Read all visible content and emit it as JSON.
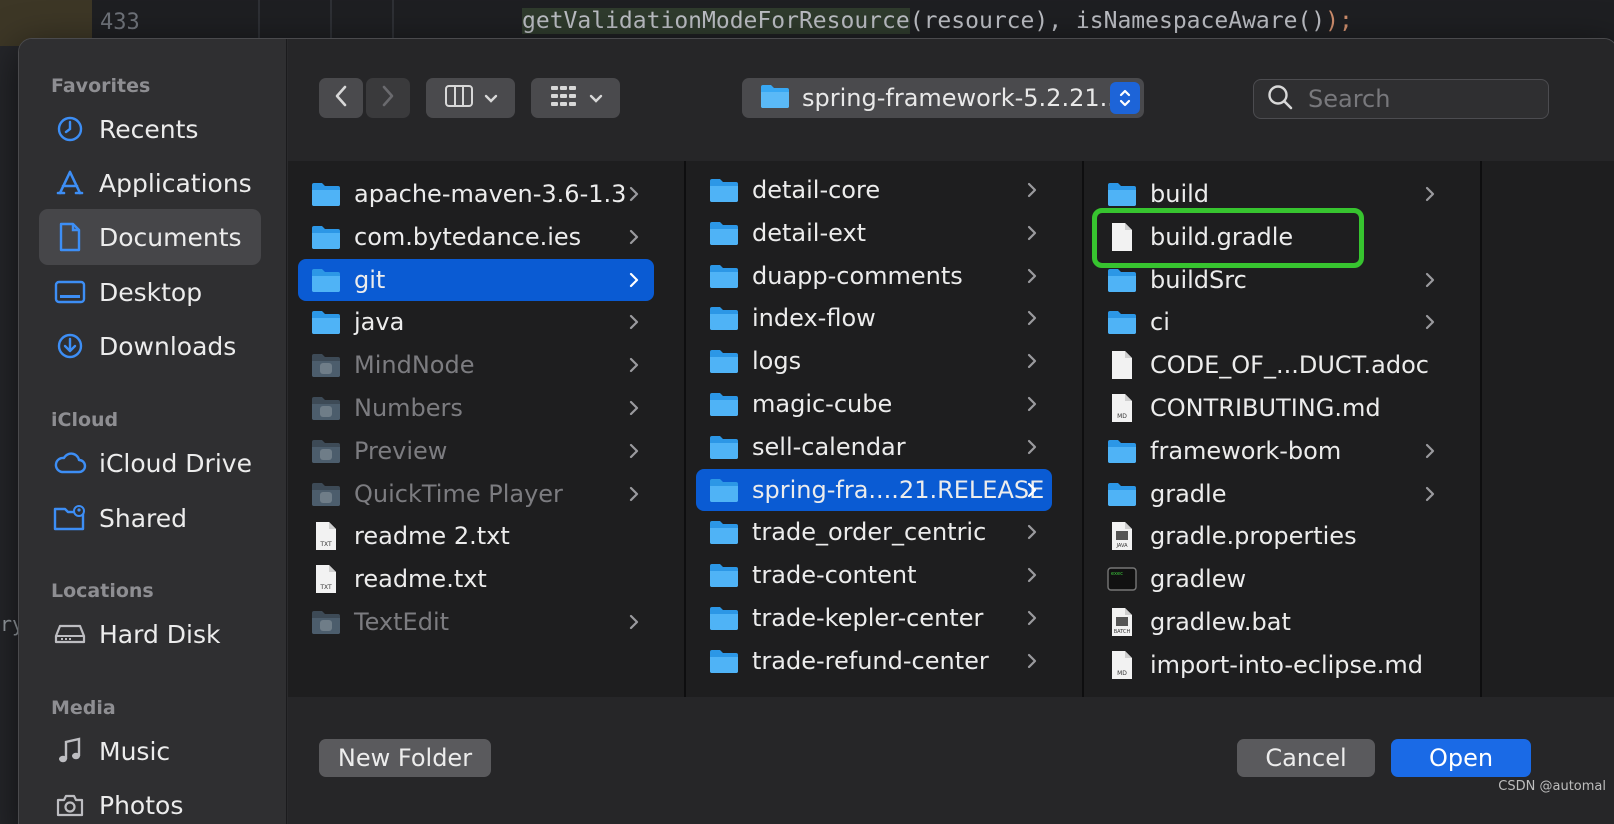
{
  "editor": {
    "line_number": "433",
    "code_highlight": "getValidationModeForResource",
    "code_rest": "(resource), isNamespaceAware()",
    "code_end": ");",
    "side_text": "ry"
  },
  "sidebar": {
    "sections": [
      {
        "title": "Favorites",
        "items": [
          {
            "label": "Recents",
            "icon": "clock-icon"
          },
          {
            "label": "Applications",
            "icon": "applications-icon"
          },
          {
            "label": "Documents",
            "icon": "document-icon",
            "selected": true
          },
          {
            "label": "Desktop",
            "icon": "desktop-icon"
          },
          {
            "label": "Downloads",
            "icon": "download-icon"
          }
        ]
      },
      {
        "title": "iCloud",
        "items": [
          {
            "label": "iCloud Drive",
            "icon": "cloud-icon"
          },
          {
            "label": "Shared",
            "icon": "shared-folder-icon"
          }
        ]
      },
      {
        "title": "Locations",
        "items": [
          {
            "label": "Hard Disk",
            "icon": "disk-icon"
          }
        ]
      },
      {
        "title": "Media",
        "items": [
          {
            "label": "Music",
            "icon": "music-icon"
          },
          {
            "label": "Photos",
            "icon": "camera-icon"
          }
        ]
      }
    ]
  },
  "toolbar": {
    "path_label": "spring-framework-5.2.21...",
    "search_placeholder": "Search"
  },
  "columns": [
    {
      "items": [
        {
          "name": "apache-maven-3.6-1.3",
          "type": "folder",
          "chevron": true
        },
        {
          "name": "com.bytedance.ies",
          "type": "folder",
          "chevron": true
        },
        {
          "name": "git",
          "type": "folder",
          "chevron": true,
          "selected": true
        },
        {
          "name": "java",
          "type": "folder",
          "chevron": true
        },
        {
          "name": "MindNode",
          "type": "app",
          "chevron": true,
          "dimmed": true
        },
        {
          "name": "Numbers",
          "type": "app",
          "chevron": true,
          "dimmed": true
        },
        {
          "name": "Preview",
          "type": "app",
          "chevron": true,
          "dimmed": true
        },
        {
          "name": "QuickTime Player",
          "type": "app",
          "chevron": true,
          "dimmed": true
        },
        {
          "name": "readme 2.txt",
          "type": "txt",
          "chevron": false
        },
        {
          "name": "readme.txt",
          "type": "txt",
          "chevron": false
        },
        {
          "name": "TextEdit",
          "type": "app",
          "chevron": true,
          "dimmed": true
        }
      ]
    },
    {
      "items": [
        {
          "name": "detail-core",
          "type": "folder",
          "chevron": true
        },
        {
          "name": "detail-ext",
          "type": "folder",
          "chevron": true
        },
        {
          "name": "duapp-comments",
          "type": "folder",
          "chevron": true
        },
        {
          "name": "index-flow",
          "type": "folder",
          "chevron": true
        },
        {
          "name": "logs",
          "type": "folder",
          "chevron": true
        },
        {
          "name": "magic-cube",
          "type": "folder",
          "chevron": true
        },
        {
          "name": "sell-calendar",
          "type": "folder",
          "chevron": true
        },
        {
          "name": "spring-fra....21.RELEASE",
          "type": "folder",
          "chevron": true,
          "selected": true
        },
        {
          "name": "trade_order_centric",
          "type": "folder",
          "chevron": true
        },
        {
          "name": "trade-content",
          "type": "folder",
          "chevron": true
        },
        {
          "name": "trade-kepler-center",
          "type": "folder",
          "chevron": true
        },
        {
          "name": "trade-refund-center",
          "type": "folder",
          "chevron": true
        }
      ]
    },
    {
      "items": [
        {
          "name": "build",
          "type": "folder",
          "chevron": true
        },
        {
          "name": "build.gradle",
          "type": "file",
          "chevron": false,
          "highlighted": true
        },
        {
          "name": "buildSrc",
          "type": "folder",
          "chevron": true
        },
        {
          "name": "ci",
          "type": "folder",
          "chevron": true
        },
        {
          "name": "CODE_OF_...DUCT.adoc",
          "type": "file",
          "chevron": false
        },
        {
          "name": "CONTRIBUTING.md",
          "type": "md",
          "chevron": false
        },
        {
          "name": "framework-bom",
          "type": "folder",
          "chevron": true
        },
        {
          "name": "gradle",
          "type": "folder",
          "chevron": true
        },
        {
          "name": "gradle.properties",
          "type": "java",
          "chevron": false
        },
        {
          "name": "gradlew",
          "type": "exec",
          "chevron": false
        },
        {
          "name": "gradlew.bat",
          "type": "batch",
          "chevron": false
        },
        {
          "name": "import-into-eclipse.md",
          "type": "md",
          "chevron": false
        }
      ]
    }
  ],
  "footer": {
    "new_folder": "New Folder",
    "cancel": "Cancel",
    "open": "Open"
  },
  "watermark": "CSDN @automal",
  "colors": {
    "accent": "#1a6ae6",
    "selection": "#0a5bd3",
    "highlight_box": "#37c42f",
    "folder_blue": "#38a8f4"
  }
}
